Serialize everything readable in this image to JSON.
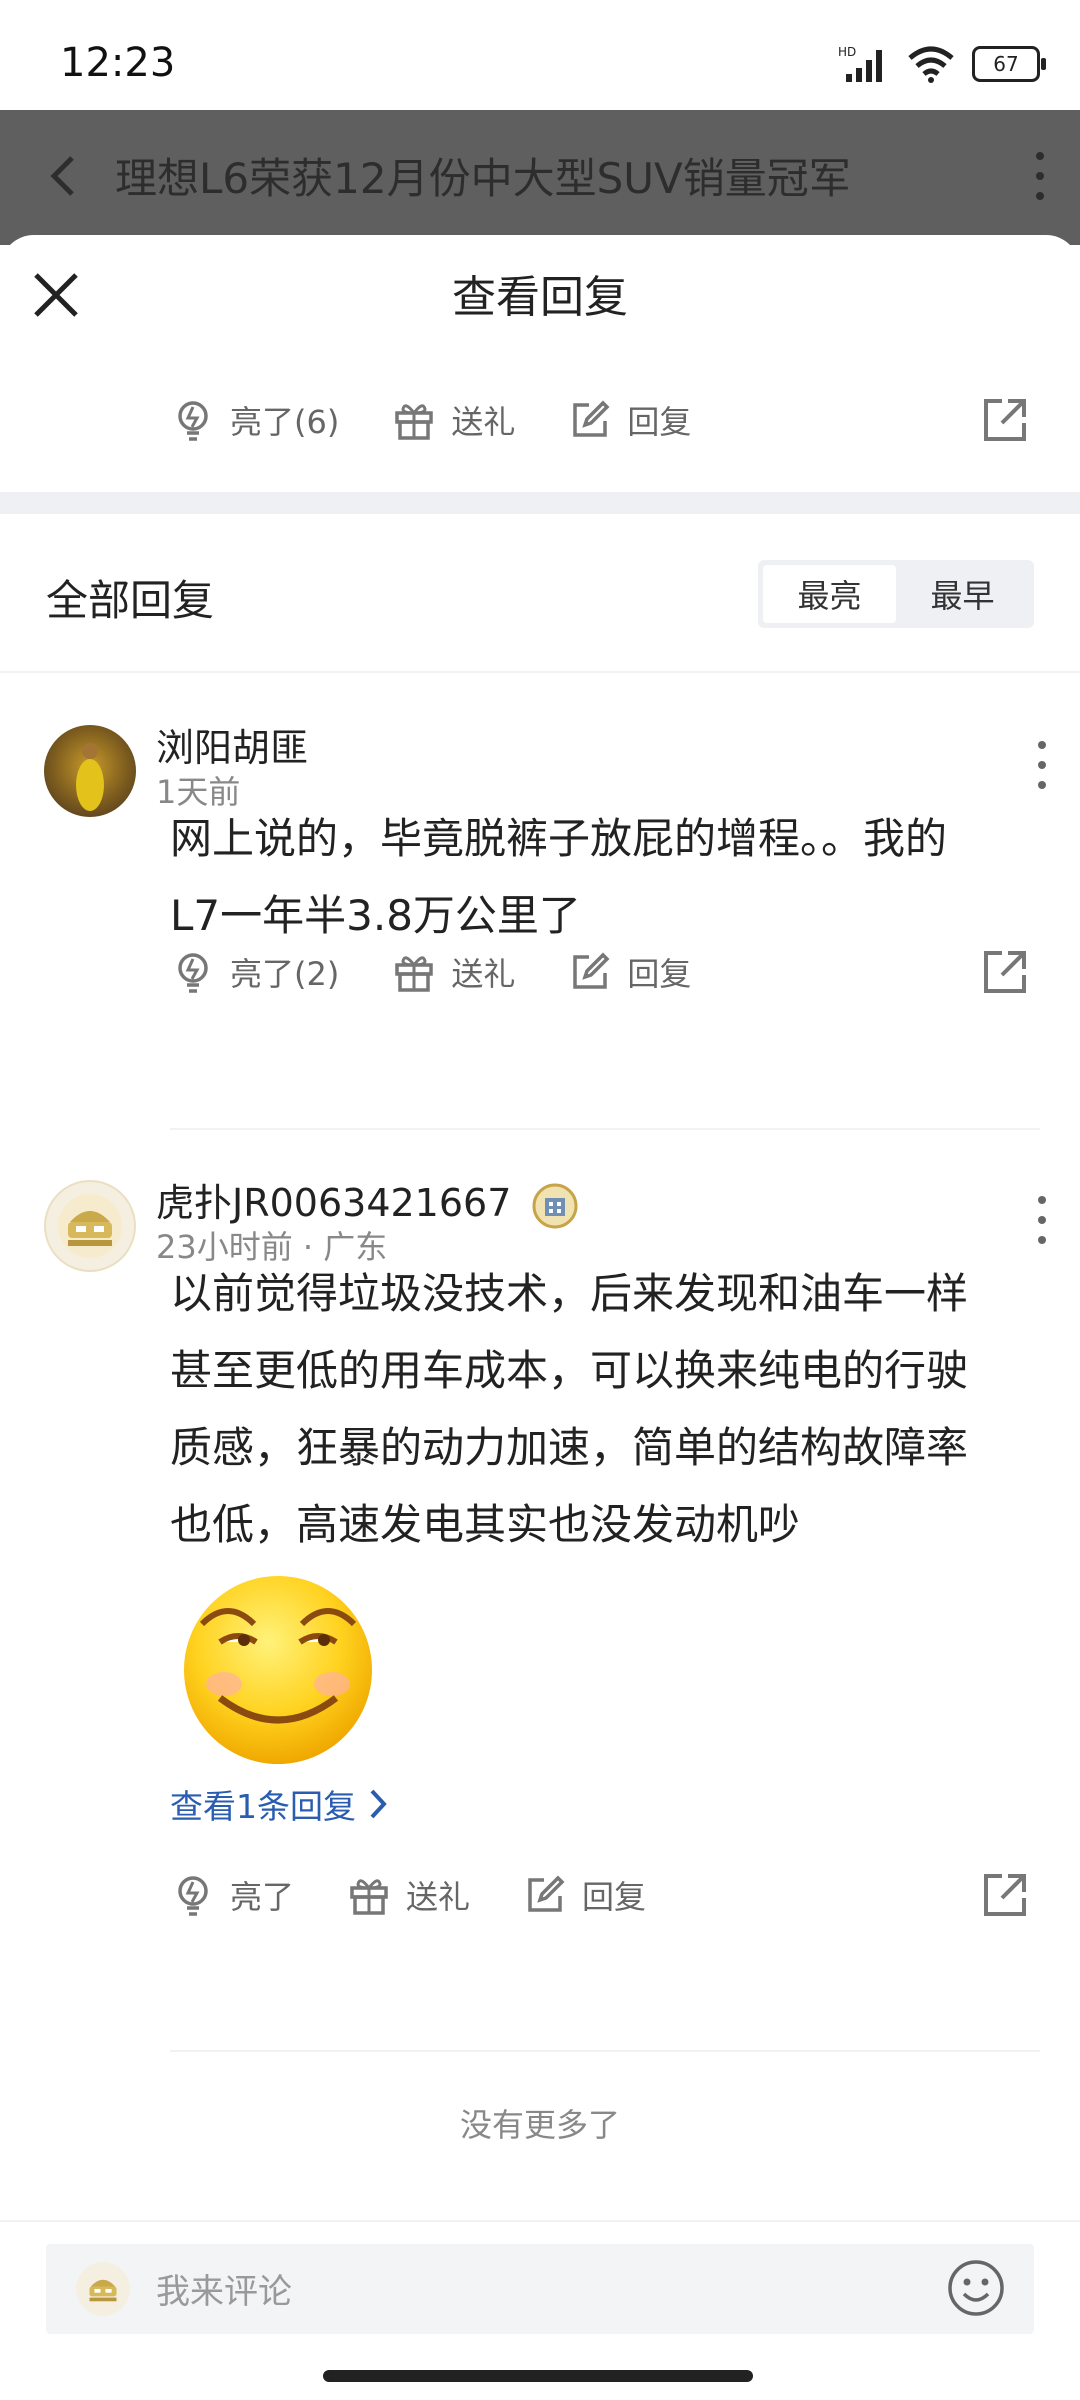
{
  "status_bar": {
    "time": "12:23",
    "battery": "67"
  },
  "page_header": {
    "title": "理想L6荣获12月份中大型SUV销量冠军"
  },
  "sheet": {
    "title": "查看回复"
  },
  "top_actions": {
    "like": "亮了(6)",
    "gift": "送礼",
    "reply": "回复"
  },
  "section": {
    "title": "全部回复",
    "sort_options": [
      "最亮",
      "最早"
    ],
    "active_sort": "最亮"
  },
  "comments": [
    {
      "username": "浏阳胡匪",
      "meta": "1天前",
      "text_lines": [
        "网上说的，毕竟脱裤子放屁的增程。。我的",
        "L7一年半3.8万公里了"
      ],
      "actions": {
        "like": "亮了(2)",
        "gift": "送礼",
        "reply": "回复"
      }
    },
    {
      "username": "虎扑JR0063421667",
      "meta": "23小时前 · 广东",
      "text_lines": [
        "以前觉得垃圾没技术，后来发现和油车一样",
        "甚至更低的用车成本，可以换来纯电的行驶",
        "质感，狂暴的动力加速，简单的结构故障率",
        "也低，高速发电其实也没发动机吵"
      ],
      "reply_link": "查看1条回复",
      "actions": {
        "like": "亮了",
        "gift": "送礼",
        "reply": "回复"
      }
    }
  ],
  "footer": {
    "no_more": "没有更多了"
  },
  "comment_input": {
    "placeholder": "我来评论"
  },
  "colors": {
    "link": "#2a5db0",
    "band": "#eef0f4",
    "dim_overlay": "#5f5f5f"
  }
}
